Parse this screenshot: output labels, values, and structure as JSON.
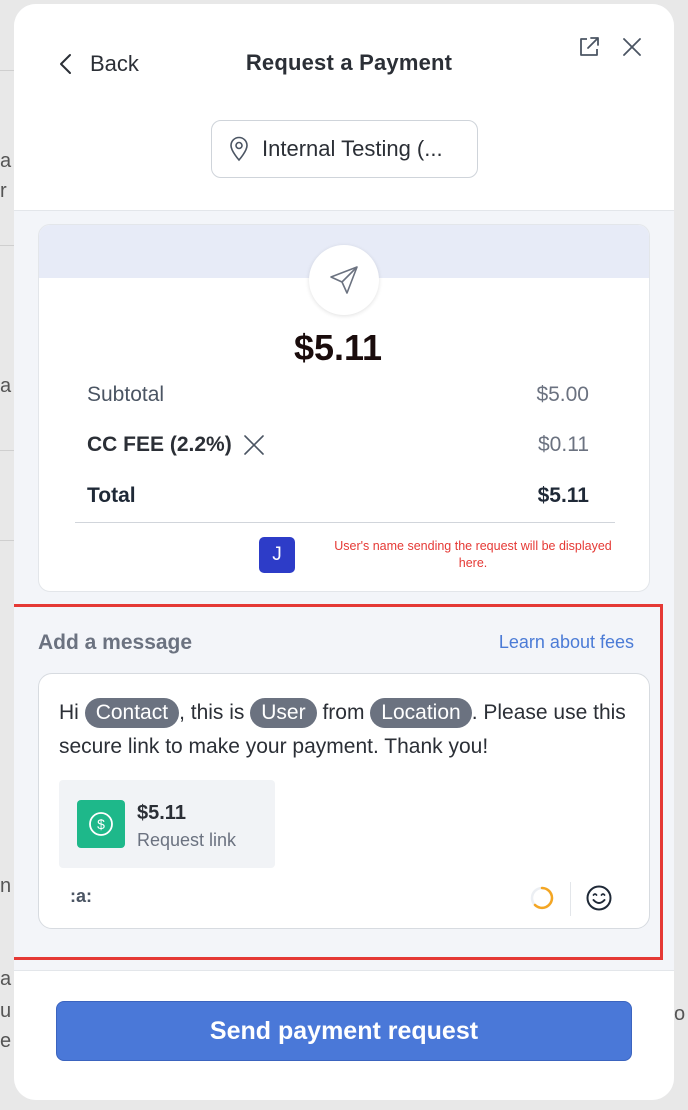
{
  "header": {
    "back_label": "Back",
    "title": "Request a Payment",
    "location": "Internal Testing (..."
  },
  "summary": {
    "amount": "$5.11",
    "subtotal_label": "Subtotal",
    "subtotal_value": "$5.00",
    "fee_label": "CC FEE (2.2%)",
    "fee_value": "$0.11",
    "total_label": "Total",
    "total_value": "$5.11",
    "avatar_initial": "J",
    "user_note": "User's name sending the request will be displayed here."
  },
  "message": {
    "heading": "Add a message",
    "fees_link": "Learn about fees",
    "text_hi": "Hi",
    "contact_tag": "Contact",
    "text_this_is": ", this is",
    "user_tag": "User",
    "text_from": "from",
    "location_tag": "Location",
    "text_rest": ". Please use this secure link to make your payment. Thank you!",
    "link_amount": "$5.11",
    "link_label": "Request link",
    "snippet_trigger": ":a:"
  },
  "footer": {
    "send_label": "Send payment request"
  },
  "colors": {
    "primary_button": "#4a78d8",
    "highlight_border": "#e53935",
    "dollar_icon_bg": "#1eb88a",
    "avatar_bg": "#2d3cc8",
    "tag_bg": "#6b7280"
  }
}
